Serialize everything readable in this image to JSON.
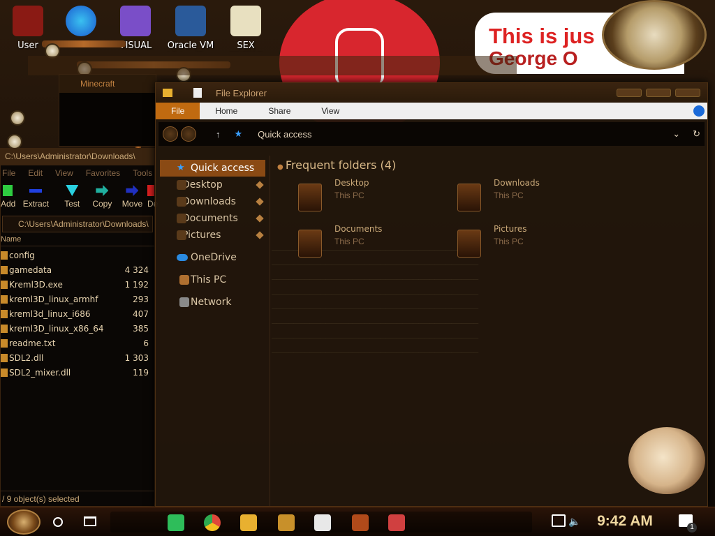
{
  "desktop": {
    "icons": [
      {
        "label": "User",
        "color": "#8a1a14"
      },
      {
        "label": "",
        "color": "#1d8fd8"
      },
      {
        "label": "VISUAL",
        "color": "#7a4ec8"
      },
      {
        "label": "Oracle VM VirtualBox",
        "color": "#2a5a9a"
      },
      {
        "label": "SEX EDITOR",
        "color": "#e8e0c0"
      }
    ],
    "banner_text": "This is jus",
    "banner_text2": "George O"
  },
  "minecraft_window": {
    "title": "Minecraft"
  },
  "zip_window": {
    "title": "C:\\Users\\Administrator\\Downloads\\",
    "menu": [
      "File",
      "Edit",
      "View",
      "Favorites",
      "Tools"
    ],
    "tools": [
      {
        "label": "Add",
        "color": "#2ecc40"
      },
      {
        "label": "Extract",
        "color": "#2040e0"
      },
      {
        "label": "Test",
        "color": "#2ad0e0"
      },
      {
        "label": "Copy",
        "color": "#20b0a0"
      },
      {
        "label": "Move",
        "color": "#2030c0"
      },
      {
        "label": "De",
        "color": "#e02020"
      }
    ],
    "path": "C:\\Users\\Administrator\\Downloads\\",
    "col_name": "Name",
    "files": [
      {
        "name": "config",
        "size": ""
      },
      {
        "name": "gamedata",
        "size": "4 324"
      },
      {
        "name": "Kreml3D.exe",
        "size": "1 192"
      },
      {
        "name": "kreml3D_linux_armhf",
        "size": "293"
      },
      {
        "name": "kreml3d_linux_i686",
        "size": "407"
      },
      {
        "name": "kreml3D_linux_x86_64",
        "size": "385"
      },
      {
        "name": "readme.txt",
        "size": "6"
      },
      {
        "name": "SDL2.dll",
        "size": "1 303"
      },
      {
        "name": "SDL2_mixer.dll",
        "size": "119"
      }
    ],
    "status": "/ 9 object(s) selected"
  },
  "explorer": {
    "title": "File Explorer",
    "ribbon_tabs": [
      "File",
      "Home",
      "Share",
      "View"
    ],
    "address": "Quick access",
    "nav": {
      "quick_access": "Quick access",
      "items": [
        "Desktop",
        "Downloads",
        "Documents",
        "Pictures"
      ],
      "onedrive": "OneDrive",
      "thispc": "This PC",
      "network": "Network"
    },
    "section_title": "Frequent folders (4)",
    "folders": [
      {
        "name": "Desktop",
        "path": "This PC"
      },
      {
        "name": "Downloads",
        "path": "This PC"
      },
      {
        "name": "Documents",
        "path": "This PC"
      },
      {
        "name": "Pictures",
        "path": "This PC"
      }
    ]
  },
  "taskbar": {
    "time": "9:42 AM",
    "apps": [
      {
        "name": "sheets-icon",
        "color": "#2ebd5a"
      },
      {
        "name": "chrome-icon",
        "color": "#e0483a"
      },
      {
        "name": "explorer-icon",
        "color": "#e8b030"
      },
      {
        "name": "game-icon",
        "color": "#c8902a"
      },
      {
        "name": "7zip-icon",
        "color": "#e8e8e8"
      },
      {
        "name": "app-icon",
        "color": "#b04a1a"
      },
      {
        "name": "virtualbox-icon",
        "color": "#d04040"
      }
    ],
    "notification_count": "1"
  }
}
